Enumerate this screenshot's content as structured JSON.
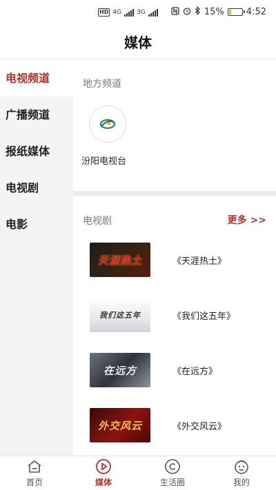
{
  "status_bar": {
    "hd_badge": "HD",
    "network_a": "4G",
    "network_b": "3G",
    "icons": [
      "nfc-icon",
      "alarm-icon",
      "bluetooth-icon"
    ],
    "battery_text": "15%",
    "battery_level": 0.15,
    "time": "4:52"
  },
  "header": {
    "title": "媒体"
  },
  "sidebar": {
    "items": [
      {
        "label": "电视频道",
        "active": true
      },
      {
        "label": "广播频道",
        "active": false
      },
      {
        "label": "报纸媒体",
        "active": false
      },
      {
        "label": "电视剧",
        "active": false
      },
      {
        "label": "电影",
        "active": false
      }
    ]
  },
  "local_channels": {
    "heading": "地方频道",
    "items": [
      {
        "name": "汾阳电视台"
      }
    ]
  },
  "dramas": {
    "heading": "电视剧",
    "more_label": "更多 >>",
    "items": [
      {
        "title": "《天涯热土》",
        "poster_text": "天涯热土"
      },
      {
        "title": "《我们这五年》",
        "poster_text": "我们这五年"
      },
      {
        "title": "《在远方》",
        "poster_text": "在远方"
      },
      {
        "title": "《外交风云》",
        "poster_text": "外交风云"
      }
    ]
  },
  "tabs": [
    {
      "label": "首页",
      "icon": "home-icon",
      "active": false
    },
    {
      "label": "媒体",
      "icon": "play-icon",
      "active": true
    },
    {
      "label": "生活圈",
      "icon": "circle-life-icon",
      "active": false
    },
    {
      "label": "我的",
      "icon": "smiley-face-icon",
      "active": false
    }
  ],
  "colors": {
    "accent": "#b8302a",
    "sidebar_bg": "#f4f4f4",
    "divider": "#ececec"
  }
}
